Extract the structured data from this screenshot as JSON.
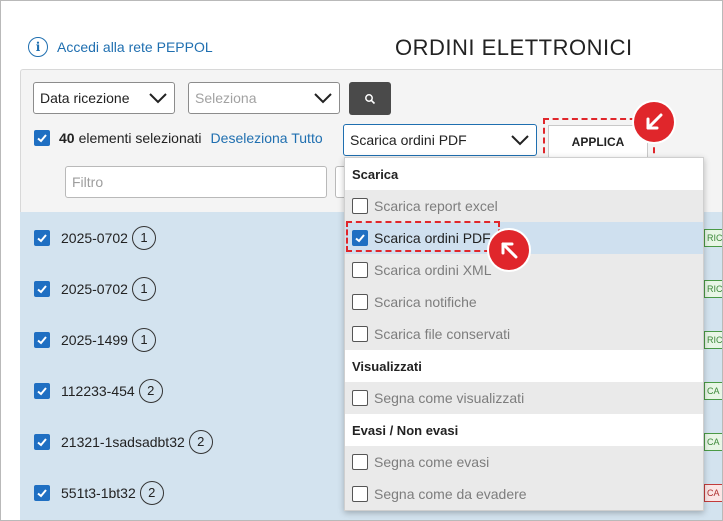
{
  "header": {
    "peppol_link": "Accedi alla rete PEPPOL",
    "page_title": "ORDINI ELETTRONICI"
  },
  "toolbar": {
    "date_filter": {
      "selected": "Data ricezione"
    },
    "second_filter": {
      "placeholder": "Seleziona"
    },
    "selected_count": "40",
    "selected_label": "elementi selezionati",
    "deselect_all": "Deseleziona Tutto",
    "action_select": {
      "selected": "Scarica ordini PDF"
    },
    "apply_label": "APPLICA",
    "filter_placeholder": "Filtro"
  },
  "rows": [
    {
      "code": "2025-0702",
      "count": "1",
      "tag": "RIC",
      "tag_color": "green"
    },
    {
      "code": "2025-0702",
      "count": "1",
      "tag": "RIC",
      "tag_color": "green"
    },
    {
      "code": "2025-1499",
      "count": "1",
      "tag": "RIC",
      "tag_color": "green"
    },
    {
      "code": "112233-454",
      "count": "2",
      "tag": "CA C",
      "tag_color": "green"
    },
    {
      "code": "21321-1sadsadbt32",
      "count": "2",
      "tag": "CA C",
      "tag_color": "green"
    },
    {
      "code": "551t3-1bt32",
      "count": "2",
      "tag": "CA S",
      "tag_color": "red"
    }
  ],
  "dropdown": {
    "groups": [
      {
        "title": "Scarica",
        "items": [
          {
            "label": "Scarica report excel",
            "checked": false
          },
          {
            "label": "Scarica ordini PDF",
            "checked": true
          },
          {
            "label": "Scarica ordini XML",
            "checked": false
          },
          {
            "label": "Scarica notifiche",
            "checked": false
          },
          {
            "label": "Scarica file conservati",
            "checked": false
          }
        ]
      },
      {
        "title": "Visualizzati",
        "items": [
          {
            "label": "Segna come visualizzati",
            "checked": false
          }
        ]
      },
      {
        "title": "Evasi / Non evasi",
        "items": [
          {
            "label": "Segna come evasi",
            "checked": false
          },
          {
            "label": "Segna come da evadere",
            "checked": false
          }
        ]
      }
    ]
  },
  "colors": {
    "accent_blue": "#1f6fc2",
    "highlight_red": "#e0262b",
    "row_selected_bg": "#d3e3ef"
  }
}
